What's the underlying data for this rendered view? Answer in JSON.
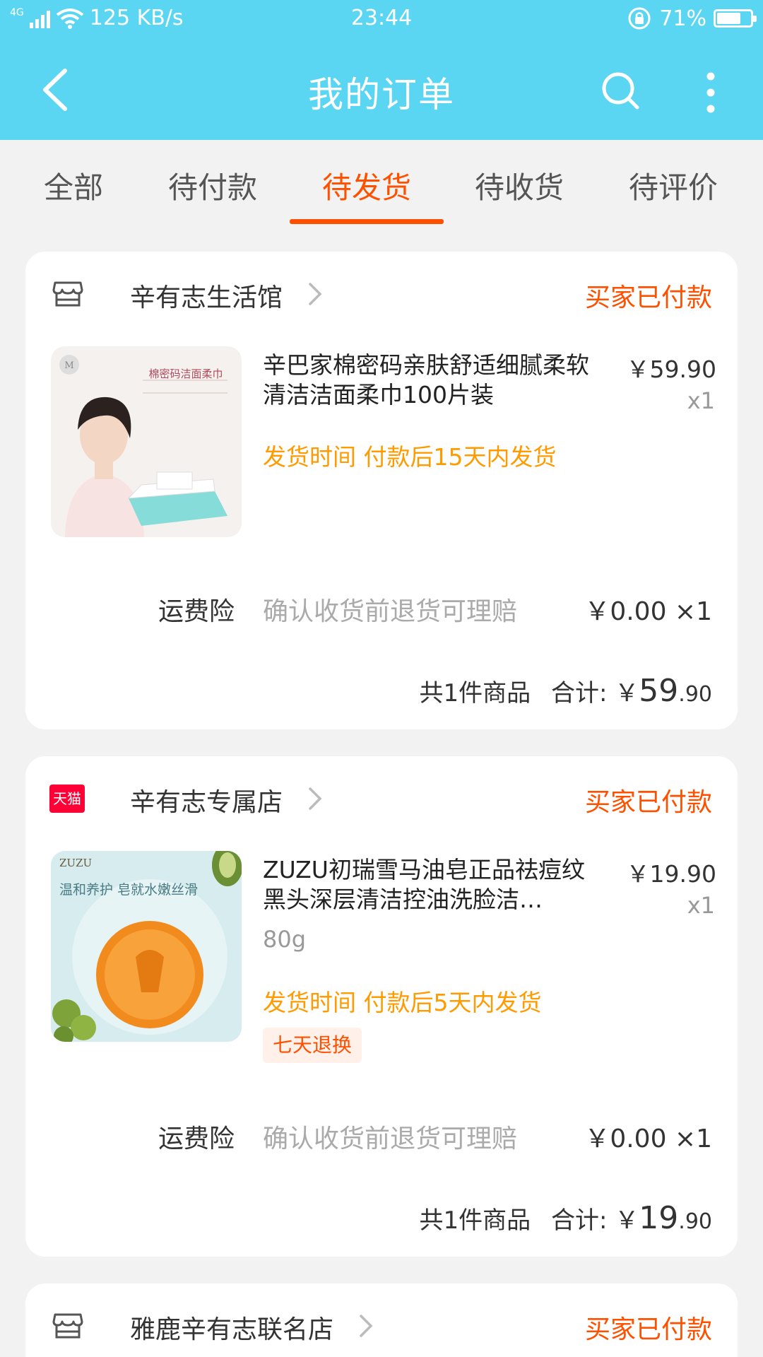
{
  "status_bar": {
    "network": "4G",
    "speed": "125 KB/s",
    "time": "23:44",
    "battery": "71%",
    "battery_level": 0.71
  },
  "header": {
    "title": "我的订单"
  },
  "tabs": [
    {
      "label": "全部"
    },
    {
      "label": "待付款"
    },
    {
      "label": "待发货",
      "active": true
    },
    {
      "label": "待收货"
    },
    {
      "label": "待评价"
    }
  ],
  "orders": [
    {
      "shop": "辛有志生活馆",
      "shop_icon": "store-icon",
      "status": "买家已付款",
      "product": {
        "title": "辛巴家棉密码亲肤舒适细腻柔软清洁洁面柔巾100片装",
        "price": "￥59.90",
        "qty": "x1",
        "ship_time": "发货时间 付款后15天内发货",
        "image_text": "棉密码洁面柔巾"
      },
      "insurance": {
        "label": "运费险",
        "desc": "确认收货前退货可理赔",
        "price": "￥0.00 ×1"
      },
      "summary": {
        "count": "共1件商品",
        "total_label": "合计:",
        "currency": "￥",
        "int": "59",
        "dec": ".90"
      }
    },
    {
      "shop": "辛有志专属店",
      "shop_icon": "tmall-icon",
      "shop_badge": "天猫",
      "status": "买家已付款",
      "product": {
        "title": "ZUZU初瑞雪马油皂正品祛痘纹黑头深层清洁控油洗脸洁…",
        "sku": "80g",
        "price": "￥19.90",
        "qty": "x1",
        "ship_time": "发货时间 付款后5天内发货",
        "tag": "七天退换",
        "image_brand": "ZUZU",
        "image_text": "温和养护 皂就水嫩丝滑"
      },
      "insurance": {
        "label": "运费险",
        "desc": "确认收货前退货可理赔",
        "price": "￥0.00 ×1"
      },
      "summary": {
        "count": "共1件商品",
        "total_label": "合计:",
        "currency": "￥",
        "int": "19",
        "dec": ".90"
      }
    },
    {
      "shop": "雅鹿辛有志联名店",
      "shop_icon": "store-icon",
      "status": "买家已付款"
    }
  ],
  "colors": {
    "header_bg": "#5bd6f2",
    "accent": "#ff5000",
    "ship_time": "#ff9b00"
  }
}
